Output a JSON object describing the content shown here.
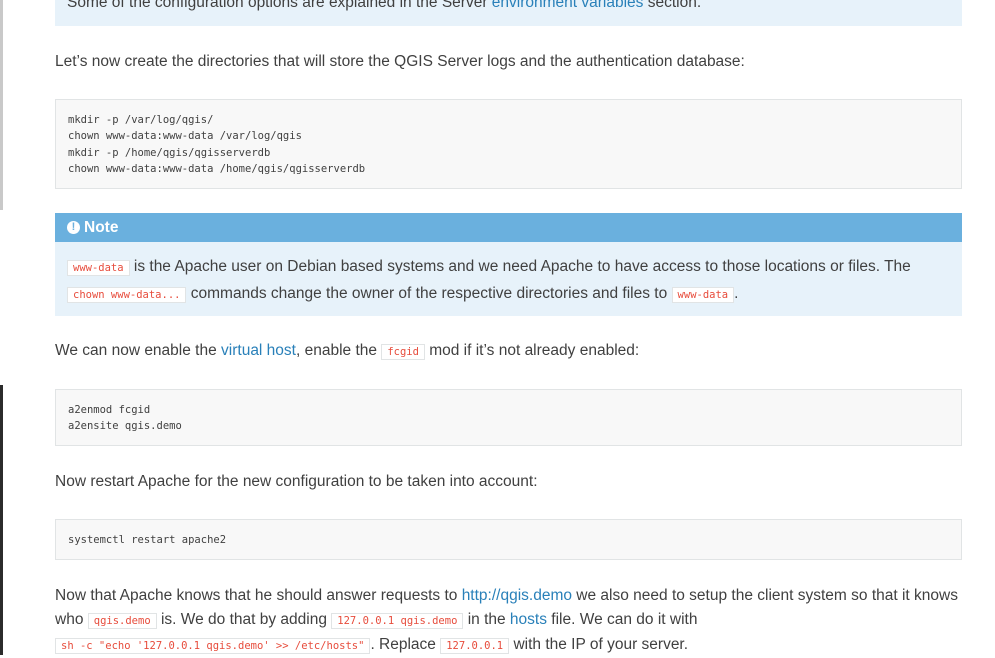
{
  "top_info": {
    "prefix": "Some of the configuration options are explained in the Server ",
    "link": "environment variables",
    "suffix": " section."
  },
  "para1": "Let’s now create the directories that will store the QGIS Server logs and the authentication database:",
  "code1": [
    "mkdir -p /var/log/qgis/",
    "chown www-data:www-data /var/log/qgis",
    "mkdir -p /home/qgis/qgisserverdb",
    "chown www-data:www-data /home/qgis/qgisserverdb"
  ],
  "note": {
    "title": "Note",
    "code_wwwdata": "www-data",
    "text1": " is the Apache user on Debian based systems and we need Apache to have access to those locations or files. The ",
    "code_chown": "chown www-data...",
    "text2": " commands change the owner of the respective directories and files to ",
    "code_wwwdata2": "www-data",
    "text3": "."
  },
  "para2": {
    "text1": "We can now enable the ",
    "link": "virtual host",
    "text2": ", enable the ",
    "code": "fcgid",
    "text3": " mod if it’s not already enabled:"
  },
  "code2": [
    "a2enmod fcgid",
    "a2ensite qgis.demo"
  ],
  "para3": "Now restart Apache for the new configuration to be taken into account:",
  "code3": [
    "systemctl restart apache2"
  ],
  "para4": {
    "text1": "Now that Apache knows that he should answer requests to ",
    "link1": "http://qgis.demo",
    "text2": " we also need to setup the client system so that it knows who ",
    "code1": "qgis.demo",
    "text3": " is. We do that by adding ",
    "code2": "127.0.0.1 qgis.demo",
    "text4": " in the ",
    "link2": "hosts",
    "text5": " file. We can do it with ",
    "code3": "sh -c \"echo '127.0.0.1 qgis.demo' >> /etc/hosts\"",
    "text6": ". Replace ",
    "code4": "127.0.0.1",
    "text7": " with the IP of your server."
  }
}
